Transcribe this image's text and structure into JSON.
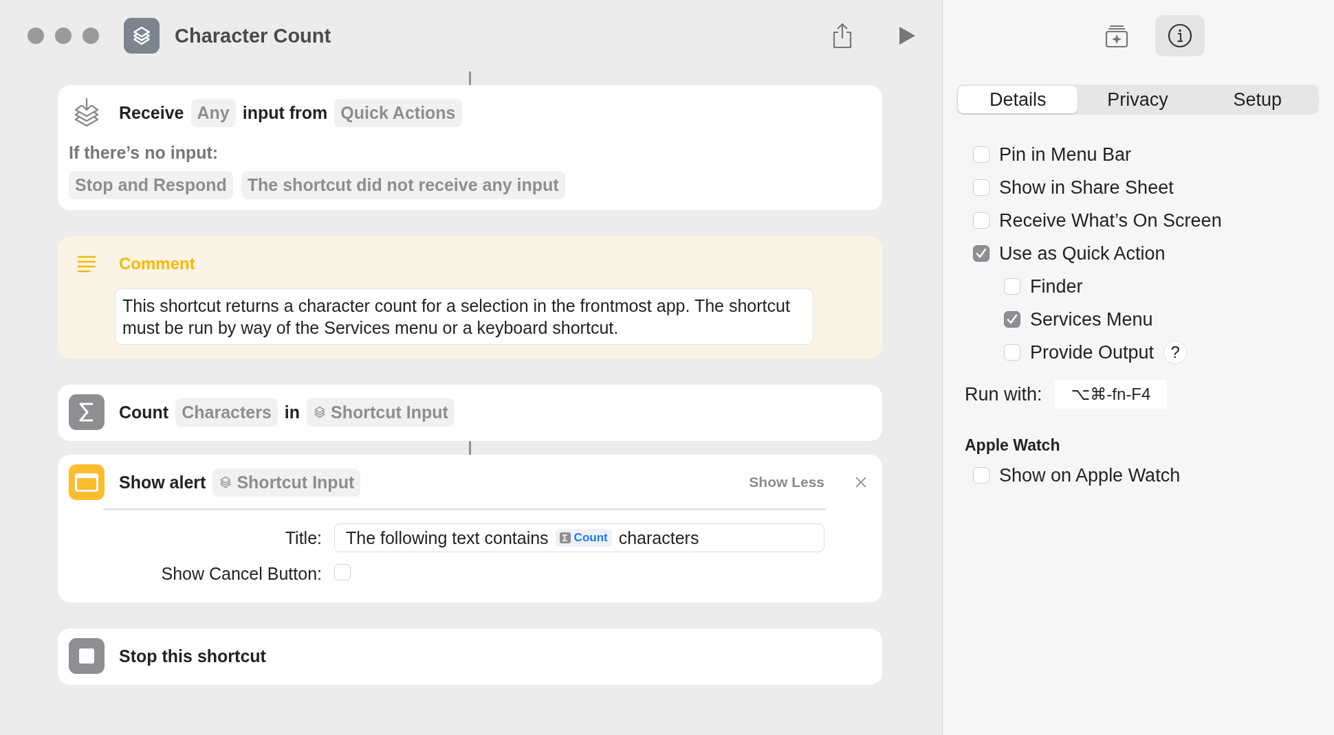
{
  "window": {
    "title": "Character Count"
  },
  "actions": [
    {
      "kind": "receive",
      "linked": true,
      "parts": [
        {
          "kind": "word",
          "text": "Receive"
        },
        {
          "kind": "token",
          "text": "Any"
        },
        {
          "kind": "word",
          "text": "input from"
        },
        {
          "kind": "token",
          "text": "Quick Actions"
        }
      ],
      "no_input_label": "If there’s no input:",
      "no_input_tokens": [
        "Stop and Respond",
        "The shortcut did not receive any input"
      ]
    },
    {
      "kind": "comment",
      "linked": false,
      "title": "Comment",
      "text": "This shortcut returns a character count for a selection in the frontmost app. The shortcut must be run by way of the Services menu or a keyboard shortcut."
    },
    {
      "kind": "count",
      "linked": false,
      "parts": [
        {
          "kind": "word",
          "text": "Count"
        },
        {
          "kind": "token",
          "text": "Characters"
        },
        {
          "kind": "word",
          "text": "in"
        },
        {
          "kind": "variable",
          "text": "Shortcut Input"
        }
      ]
    },
    {
      "kind": "alert",
      "linked": true,
      "parts": [
        {
          "kind": "word",
          "text": "Show alert"
        },
        {
          "kind": "variable",
          "text": "Shortcut Input"
        }
      ],
      "toggle": "Show Less",
      "fields": [
        {
          "kind": "text",
          "label": "Title:",
          "parts": [
            {
              "kind": "text",
              "text": "The following text contains"
            },
            {
              "kind": "chip",
              "text": "Count"
            },
            {
              "kind": "text",
              "text": "characters"
            }
          ]
        },
        {
          "kind": "checkbox",
          "label": "Show Cancel Button:",
          "checked": false
        }
      ]
    },
    {
      "kind": "stop",
      "linked": false,
      "parts": [
        {
          "kind": "word",
          "text": "Stop this shortcut"
        }
      ]
    }
  ],
  "inspector": {
    "toolbar": [
      {
        "kind": "gallery",
        "selected": false
      },
      {
        "kind": "info",
        "selected": true
      }
    ],
    "tabs": [
      {
        "label": "Details",
        "selected": true
      },
      {
        "label": "Privacy",
        "selected": false
      },
      {
        "label": "Setup",
        "selected": false
      }
    ],
    "options": [
      {
        "label": "Pin in Menu Bar",
        "checked": false
      },
      {
        "label": "Show in Share Sheet",
        "checked": false
      },
      {
        "label": "Receive What’s On Screen",
        "checked": false
      },
      {
        "label": "Use as Quick Action",
        "checked": true,
        "children": [
          {
            "label": "Finder",
            "checked": false
          },
          {
            "label": "Services Menu",
            "checked": true
          },
          {
            "label": "Provide Output",
            "checked": false,
            "help": "?"
          }
        ]
      }
    ],
    "run_with": {
      "label": "Run with:",
      "value": "⌥⌘-fn-F4"
    },
    "sections": [
      {
        "title": "Apple Watch",
        "options": [
          {
            "label": "Show on Apple Watch",
            "checked": false
          }
        ]
      }
    ]
  }
}
